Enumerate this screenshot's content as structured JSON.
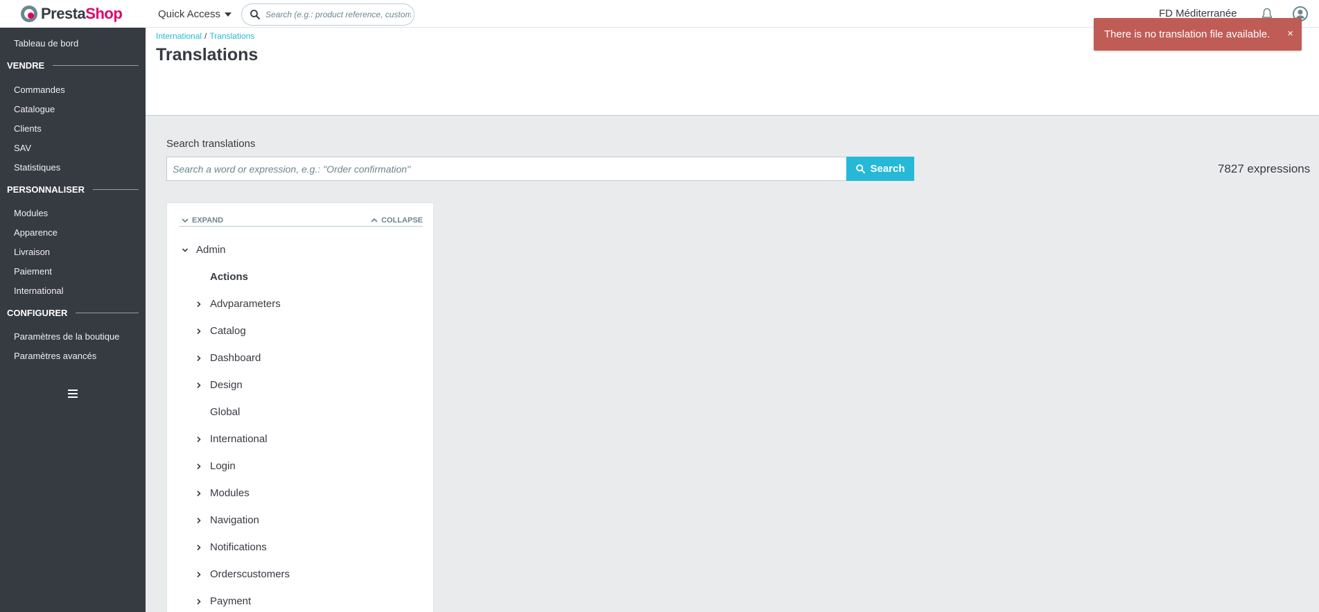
{
  "header": {
    "logo_part1": "Presta",
    "logo_part2": "Shop",
    "quick_access": "Quick Access",
    "search_placeholder": "Search (e.g.: product reference, customer",
    "shop_name": "FD Méditerranée"
  },
  "sidebar": {
    "dashboard": "Tableau de bord",
    "sections": [
      {
        "title": "VENDRE",
        "items": [
          "Commandes",
          "Catalogue",
          "Clients",
          "SAV",
          "Statistiques"
        ]
      },
      {
        "title": "PERSONNALISER",
        "items": [
          "Modules",
          "Apparence",
          "Livraison",
          "Paiement",
          "International"
        ]
      },
      {
        "title": "CONFIGURER",
        "items": [
          "Paramètres de la boutique",
          "Paramètres avancés"
        ]
      }
    ]
  },
  "breadcrumb": {
    "parent": "International",
    "separator": "/",
    "current": "Translations"
  },
  "page_title": "Translations",
  "alert": {
    "message": "There is no translation file available.",
    "close": "×"
  },
  "search": {
    "label": "Search translations",
    "placeholder": "Search a word or expression, e.g.: \"Order confirmation\"",
    "button": "Search",
    "count": "7827 expressions"
  },
  "tree": {
    "expand": "EXPAND",
    "collapse": "COLLAPSE",
    "root": "Admin",
    "items": [
      {
        "label": "Actions",
        "has_children": false,
        "selected": true
      },
      {
        "label": "Advparameters",
        "has_children": true
      },
      {
        "label": "Catalog",
        "has_children": true
      },
      {
        "label": "Dashboard",
        "has_children": true
      },
      {
        "label": "Design",
        "has_children": true
      },
      {
        "label": "Global",
        "has_children": false
      },
      {
        "label": "International",
        "has_children": true
      },
      {
        "label": "Login",
        "has_children": true
      },
      {
        "label": "Modules",
        "has_children": true
      },
      {
        "label": "Navigation",
        "has_children": true
      },
      {
        "label": "Notifications",
        "has_children": true
      },
      {
        "label": "Orderscustomers",
        "has_children": true
      },
      {
        "label": "Payment",
        "has_children": true
      }
    ]
  },
  "colors": {
    "sidebar_bg": "#363a41",
    "accent": "#25b9d7",
    "alert_bg": "#c05c56",
    "logo_pink": "#df0067"
  }
}
